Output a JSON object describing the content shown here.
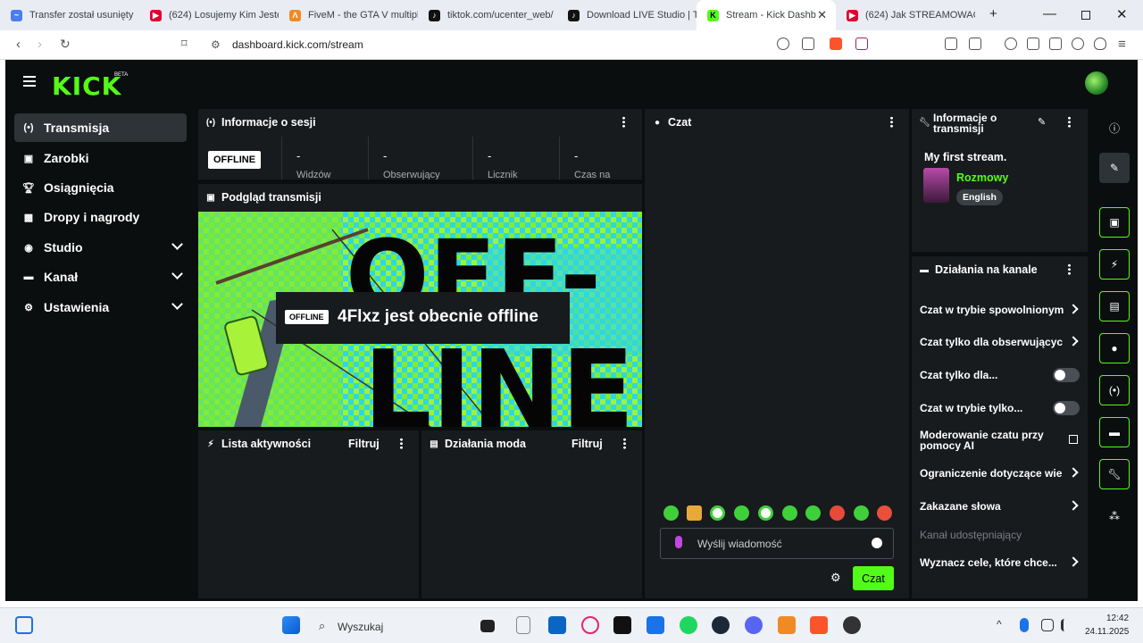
{
  "browser": {
    "tabs": [
      {
        "label": "Transfer został usunięty",
        "icon": "wetransfer-icon",
        "color": "#4a7df0"
      },
      {
        "label": "(624) Losujemy Kim Jeste",
        "icon": "youtube-icon",
        "color": "#e00030"
      },
      {
        "label": "FiveM - the GTA V multipl",
        "icon": "fivem-icon",
        "color": "#f08a24"
      },
      {
        "label": "tiktok.com/ucenter_web/",
        "icon": "tiktok-icon",
        "color": "#111111"
      },
      {
        "label": "Download LIVE Studio | T",
        "icon": "tiktok-icon",
        "color": "#111111"
      },
      {
        "label": "Stream - Kick Dashb",
        "icon": "kick-icon",
        "color": "#53fc18"
      },
      {
        "label": "(624) Jak STREAMOWAĆ",
        "icon": "youtube-icon",
        "color": "#e00030"
      }
    ],
    "url": "dashboard.kick.com/stream"
  },
  "app": {
    "logo": "KICK",
    "logo_badge": "BETA",
    "sidebar": [
      {
        "label": "Transmisja",
        "icon": "broadcast-icon",
        "active": true
      },
      {
        "label": "Zarobki",
        "icon": "earnings-icon"
      },
      {
        "label": "Osiągnięcia",
        "icon": "trophy-icon"
      },
      {
        "label": "Dropy i nagrody",
        "icon": "gift-icon"
      },
      {
        "label": "Studio",
        "icon": "studio-icon",
        "expandable": true
      },
      {
        "label": "Kanał",
        "icon": "channel-icon",
        "expandable": true
      },
      {
        "label": "Ustawienia",
        "icon": "gear-icon",
        "expandable": true
      }
    ],
    "session": {
      "title": "Informacje o sesji",
      "status": "OFFLINE",
      "stats": [
        {
          "value": "-",
          "label": "Widzów"
        },
        {
          "value": "-",
          "label": "Obserwujący"
        },
        {
          "value": "-",
          "label": "Licznik"
        },
        {
          "value": "-",
          "label": "Czas na"
        }
      ]
    },
    "preview": {
      "title": "Podgląd transmisji",
      "badge": "OFFLINE",
      "message": "4Flxz jest obecnie offline",
      "bg_text_top": "OFF-",
      "bg_text_bottom": "LINE"
    },
    "activity": {
      "title": "Lista aktywności",
      "filter": "Filtruj"
    },
    "modactions": {
      "title": "Działania moda",
      "filter": "Filtruj"
    },
    "chat": {
      "title": "Czat",
      "placeholder": "Wyślij wiadomość",
      "send_label": "Czat",
      "emote_count": 10
    },
    "stream_info": {
      "title_line1": "Informacje o",
      "title_line2": "transmisji",
      "stream_title": "My first stream.",
      "category": "Rozmowy",
      "language": "English"
    },
    "channel_actions": {
      "title": "Działania na kanale",
      "items": [
        {
          "label": "Czat w trybie spowolnionym",
          "control": "chevron"
        },
        {
          "label": "Czat tylko dla obserwującyc",
          "control": "chevron"
        },
        {
          "label": "Czat tylko dla...",
          "control": "toggle"
        },
        {
          "label": "Czat w trybie tylko...",
          "control": "toggle"
        },
        {
          "label": "Moderowanie czatu przy",
          "label2": "pomocy AI",
          "control": "external"
        },
        {
          "label": "Ograniczenie dotyczące wie",
          "control": "chevron"
        },
        {
          "label": "Zakazane słowa",
          "control": "chevron"
        },
        {
          "label": "Kanał udostępniający",
          "control": "none",
          "disabled": true
        },
        {
          "label": "Wyznacz cele, które chce...",
          "control": "chevron"
        }
      ]
    },
    "accent": "#53fc18"
  },
  "taskbar": {
    "search": "Wyszukaj",
    "time": "12:42",
    "date": "24.11.2025"
  }
}
